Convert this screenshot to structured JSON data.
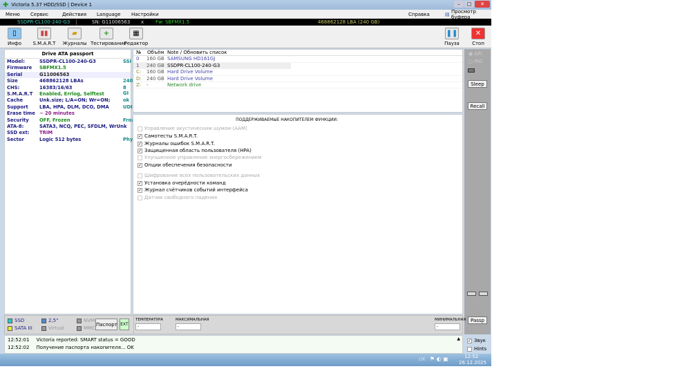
{
  "title": "Victoria 5.37 HDD/SSD | Device 1",
  "menu": [
    "Меню",
    "Сервис",
    "Действия",
    "Language",
    "Настройки"
  ],
  "menu_right": {
    "help": "Справка",
    "buffer": "Просмотр буфера"
  },
  "status": {
    "model": "SSDPR-CL100-240-G3",
    "sn": "SN: G11006563",
    "x": "x",
    "fw": "Fw: SBFMX1.5",
    "lba": "468862128 LBA (240 GB)"
  },
  "toolbar": {
    "info": "Инфо",
    "smart": "S.M.A.R.T",
    "logs": "Журналы",
    "test": "Тестирование",
    "editor": "Редактор",
    "pause": "Пауза",
    "stop": "Стоп"
  },
  "passport": {
    "title": "Drive ATA passport",
    "rows": [
      {
        "k": "Model:",
        "v": "SSDPR-CL100-240-G3",
        "e": "SSI",
        "c": "#1a1a80"
      },
      {
        "k": "Firmware",
        "v": "SBFMX1.5",
        "e": "",
        "c": "#1a8a1a"
      },
      {
        "k": "Serial",
        "v": "G11006563",
        "e": "",
        "c": "#222"
      },
      {
        "k": "Size",
        "v": "468862128 LBAs",
        "e": "240",
        "c": "#1a1a80"
      },
      {
        "k": "CHS:",
        "v": "16383/16/63",
        "e": "8 GI",
        "c": "#1a1a80"
      },
      {
        "k": "S.M.A.R.T",
        "v": "Enabled, Errlog, Selftest",
        "e": "",
        "c": "#1a8a1a"
      },
      {
        "k": "Cache",
        "v": "Unk.size; L/A=ON; Wr=ON;",
        "e": "ok",
        "c": "#1a1a80"
      },
      {
        "k": "Support",
        "v": "LBA, HPA, DLM, DCO, DMA",
        "e": "UDI",
        "c": "#1a1a80"
      },
      {
        "k": "Erase time",
        "v": "~ 20 minutes",
        "e": "",
        "c": "#8a1a8a"
      },
      {
        "k": "Security",
        "v": "OFF, Frozen",
        "e": "Froz",
        "c": "#1a8a1a"
      },
      {
        "k": "ATA-8:",
        "v": "SATA3, NCQ, PEC, SFDLM, WrUnk",
        "e": "",
        "c": "#1a1a80"
      },
      {
        "k": "SSD ext:",
        "v": "TRIM",
        "e": "",
        "c": "#8a1a8a"
      },
      {
        "k": "Sector",
        "v": "Logic 512 bytes",
        "e": "Phy",
        "c": "#1a1a80"
      }
    ]
  },
  "drives": {
    "headers": [
      "№",
      "Объём",
      "Note / Обновить список"
    ],
    "rows": [
      {
        "n": "0",
        "s": "160 GB",
        "note": "SAMSUNG HD161GJ",
        "c": "#44a"
      },
      {
        "n": "1",
        "s": "240 GB",
        "note": "SSDPR-CL100-240-G3",
        "c": "#000"
      },
      {
        "n": "C:",
        "s": "160 GB",
        "note": "Hard Drive Volume",
        "c": "#44a"
      },
      {
        "n": "D:",
        "s": "240 GB",
        "note": "Hard Drive Volume",
        "c": "#44a"
      },
      {
        "n": "Z:",
        "s": "-",
        "note": "Network drive",
        "c": "#2a8a2a"
      }
    ]
  },
  "features": {
    "title": "ПОДДЕРЖИВАЕМЫЕ НАКОПИТЕЛЕМ ФУНКЦИИ:",
    "items": [
      {
        "label": "Управление акустическим шумом (AAM)",
        "checked": false
      },
      {
        "label": "Самотесты S.M.A.R.T.",
        "checked": true
      },
      {
        "label": "Журналы ошибок S.M.A.R.T.",
        "checked": true
      },
      {
        "label": "Защищенная область пользователя (HPA)",
        "checked": true
      },
      {
        "label": "Улучшенное управление энергосбережением",
        "checked": false
      },
      {
        "label": "Опции обеспечения безопасности",
        "checked": true
      },
      {
        "label": "Шифрование всех пользовательских данных",
        "checked": false
      },
      {
        "label": "Установка очерёдности команд",
        "checked": true
      },
      {
        "label": "Журнал счётчиков событий интерфейса",
        "checked": true
      },
      {
        "label": "Датчик свободного падения",
        "checked": false
      }
    ]
  },
  "right": {
    "api": "API",
    "pio": "PIO",
    "sleep": "Sleep",
    "recall": "Recall",
    "passp": "Passp",
    "sound": "Звук",
    "hints": "Hints"
  },
  "legend": {
    "ssd": "SSD",
    "sata": "SATA III",
    "size": "2,5\"",
    "virtual": "Virtual",
    "nvme": "NVMe",
    "mmc": "MMC",
    "passport_btn": "Паспорт",
    "ext": "EXT"
  },
  "temps": {
    "temp": "ТЕМПЕРАТУРА",
    "max": "МАКСИМАЛЬНАЯ",
    "min": "МИНИМАЛЬНАЯ",
    "temp_v": "-",
    "max_v": "-",
    "min_v": "-"
  },
  "log": [
    {
      "t": "12:52:01",
      "m": "Victoria reported: SMART status = GOOD"
    },
    {
      "t": "12:52:02",
      "m": "Получение паспорта накопителя... OK"
    }
  ],
  "taskbar": {
    "lang": "UK",
    "time": "12:52",
    "date": "26.12.2025"
  }
}
